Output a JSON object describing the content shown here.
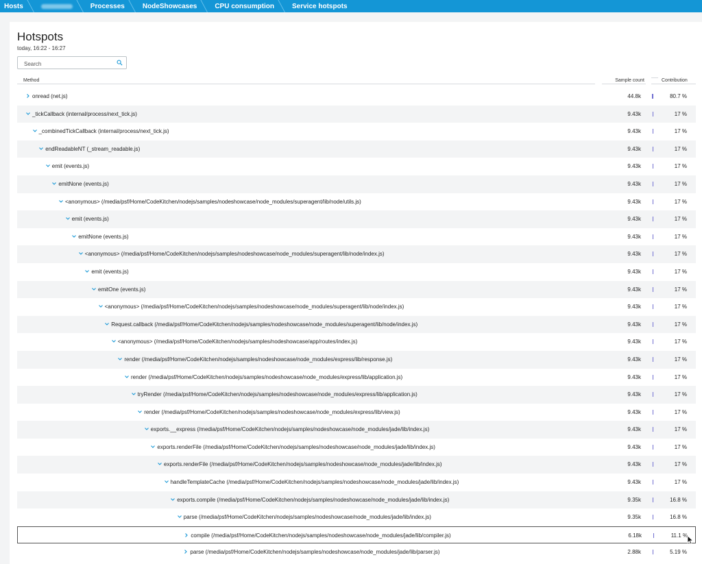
{
  "breadcrumb": [
    {
      "label": "Hosts",
      "blurred": false
    },
    {
      "label": "",
      "blurred": true
    },
    {
      "label": "Processes",
      "blurred": false
    },
    {
      "label": "NodeShowcases",
      "blurred": false
    },
    {
      "label": "CPU consumption",
      "blurred": false
    },
    {
      "label": "Service hotspots",
      "blurred": false,
      "active": true
    }
  ],
  "page": {
    "title": "Hotspots",
    "timeframe": "today, 16:22 - 16:27"
  },
  "search": {
    "placeholder": "Search",
    "value": ""
  },
  "table": {
    "headers": {
      "method": "Method",
      "samples": "Sample count",
      "contribution": "Contribution"
    },
    "rows": [
      {
        "depth": 0,
        "expanded": false,
        "method": "onread (net.js)",
        "samples": "44.8k",
        "contribution": "80.7 %",
        "fraction": 0.807
      },
      {
        "depth": 0,
        "expanded": true,
        "method": "_tickCallback (internal/process/next_tick.js)",
        "samples": "9.43k",
        "contribution": "17 %",
        "fraction": 0.17
      },
      {
        "depth": 1,
        "expanded": true,
        "method": "_combinedTickCallback (internal/process/next_tick.js)",
        "samples": "9.43k",
        "contribution": "17 %",
        "fraction": 0.17
      },
      {
        "depth": 2,
        "expanded": true,
        "method": "endReadableNT (_stream_readable.js)",
        "samples": "9.43k",
        "contribution": "17 %",
        "fraction": 0.17
      },
      {
        "depth": 3,
        "expanded": true,
        "method": "emit (events.js)",
        "samples": "9.43k",
        "contribution": "17 %",
        "fraction": 0.17
      },
      {
        "depth": 4,
        "expanded": true,
        "method": "emitNone (events.js)",
        "samples": "9.43k",
        "contribution": "17 %",
        "fraction": 0.17
      },
      {
        "depth": 5,
        "expanded": true,
        "method": "<anonymous> (/media/psf/Home/CodeKitchen/nodejs/samples/nodeshowcase/node_modules/superagent/lib/node/utils.js)",
        "samples": "9.43k",
        "contribution": "17 %",
        "fraction": 0.17
      },
      {
        "depth": 6,
        "expanded": true,
        "method": "emit (events.js)",
        "samples": "9.43k",
        "contribution": "17 %",
        "fraction": 0.17
      },
      {
        "depth": 7,
        "expanded": true,
        "method": "emitNone (events.js)",
        "samples": "9.43k",
        "contribution": "17 %",
        "fraction": 0.17
      },
      {
        "depth": 8,
        "expanded": true,
        "method": "<anonymous> (/media/psf/Home/CodeKitchen/nodejs/samples/nodeshowcase/node_modules/superagent/lib/node/index.js)",
        "samples": "9.43k",
        "contribution": "17 %",
        "fraction": 0.17
      },
      {
        "depth": 9,
        "expanded": true,
        "method": "emit (events.js)",
        "samples": "9.43k",
        "contribution": "17 %",
        "fraction": 0.17
      },
      {
        "depth": 10,
        "expanded": true,
        "method": "emitOne (events.js)",
        "samples": "9.43k",
        "contribution": "17 %",
        "fraction": 0.17
      },
      {
        "depth": 11,
        "expanded": true,
        "method": "<anonymous> (/media/psf/Home/CodeKitchen/nodejs/samples/nodeshowcase/node_modules/superagent/lib/node/index.js)",
        "samples": "9.43k",
        "contribution": "17 %",
        "fraction": 0.17
      },
      {
        "depth": 12,
        "expanded": true,
        "method": "Request.callback (/media/psf/Home/CodeKitchen/nodejs/samples/nodeshowcase/node_modules/superagent/lib/node/index.js)",
        "samples": "9.43k",
        "contribution": "17 %",
        "fraction": 0.17
      },
      {
        "depth": 13,
        "expanded": true,
        "method": "<anonymous> (/media/psf/Home/CodeKitchen/nodejs/samples/nodeshowcase/app/routes/index.js)",
        "samples": "9.43k",
        "contribution": "17 %",
        "fraction": 0.17
      },
      {
        "depth": 14,
        "expanded": true,
        "method": "render (/media/psf/Home/CodeKitchen/nodejs/samples/nodeshowcase/node_modules/express/lib/response.js)",
        "samples": "9.43k",
        "contribution": "17 %",
        "fraction": 0.17
      },
      {
        "depth": 15,
        "expanded": true,
        "method": "render (/media/psf/Home/CodeKitchen/nodejs/samples/nodeshowcase/node_modules/express/lib/application.js)",
        "samples": "9.43k",
        "contribution": "17 %",
        "fraction": 0.17
      },
      {
        "depth": 16,
        "expanded": true,
        "method": "tryRender (/media/psf/Home/CodeKitchen/nodejs/samples/nodeshowcase/node_modules/express/lib/application.js)",
        "samples": "9.43k",
        "contribution": "17 %",
        "fraction": 0.17
      },
      {
        "depth": 17,
        "expanded": true,
        "method": "render (/media/psf/Home/CodeKitchen/nodejs/samples/nodeshowcase/node_modules/express/lib/view.js)",
        "samples": "9.43k",
        "contribution": "17 %",
        "fraction": 0.17
      },
      {
        "depth": 18,
        "expanded": true,
        "method": "exports.__express (/media/psf/Home/CodeKitchen/nodejs/samples/nodeshowcase/node_modules/jade/lib/index.js)",
        "samples": "9.43k",
        "contribution": "17 %",
        "fraction": 0.17
      },
      {
        "depth": 19,
        "expanded": true,
        "method": "exports.renderFile (/media/psf/Home/CodeKitchen/nodejs/samples/nodeshowcase/node_modules/jade/lib/index.js)",
        "samples": "9.43k",
        "contribution": "17 %",
        "fraction": 0.17
      },
      {
        "depth": 20,
        "expanded": true,
        "method": "exports.renderFile (/media/psf/Home/CodeKitchen/nodejs/samples/nodeshowcase/node_modules/jade/lib/index.js)",
        "samples": "9.43k",
        "contribution": "17 %",
        "fraction": 0.17
      },
      {
        "depth": 21,
        "expanded": true,
        "method": "handleTemplateCache (/media/psf/Home/CodeKitchen/nodejs/samples/nodeshowcase/node_modules/jade/lib/index.js)",
        "samples": "9.43k",
        "contribution": "17 %",
        "fraction": 0.17
      },
      {
        "depth": 22,
        "expanded": true,
        "method": "exports.compile (/media/psf/Home/CodeKitchen/nodejs/samples/nodeshowcase/node_modules/jade/lib/index.js)",
        "samples": "9.35k",
        "contribution": "16.8 %",
        "fraction": 0.168
      },
      {
        "depth": 23,
        "expanded": true,
        "method": "parse (/media/psf/Home/CodeKitchen/nodejs/samples/nodeshowcase/node_modules/jade/lib/index.js)",
        "samples": "9.35k",
        "contribution": "16.8 %",
        "fraction": 0.168
      },
      {
        "depth": 24,
        "expanded": false,
        "selected": true,
        "method": "compile (/media/psf/Home/CodeKitchen/nodejs/samples/nodeshowcase/node_modules/jade/lib/compiler.js)",
        "samples": "6.18k",
        "contribution": "11.1 %",
        "fraction": 0.111
      },
      {
        "depth": 24,
        "expanded": false,
        "method": "parse (/media/psf/Home/CodeKitchen/nodejs/samples/nodeshowcase/node_modules/jade/lib/parser.js)",
        "samples": "2.88k",
        "contribution": "5.19 %",
        "fraction": 0.0519
      }
    ]
  },
  "colors": {
    "accent": "#1496d6",
    "bar": "#6d6bd0",
    "chevron": "#1496d6"
  }
}
